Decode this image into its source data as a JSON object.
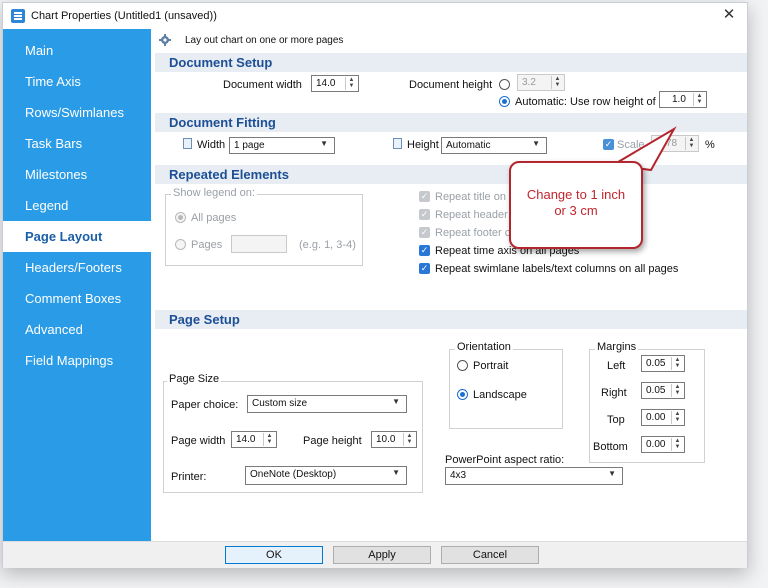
{
  "window": {
    "title": "Chart Properties (Untitled1 (unsaved))"
  },
  "sidebar": {
    "items": [
      {
        "label": "Main"
      },
      {
        "label": "Time Axis"
      },
      {
        "label": "Rows/Swimlanes"
      },
      {
        "label": "Task Bars"
      },
      {
        "label": "Milestones"
      },
      {
        "label": "Legend"
      },
      {
        "label": "Page Layout",
        "active": true
      },
      {
        "label": "Headers/Footers"
      },
      {
        "label": "Comment Boxes"
      },
      {
        "label": "Advanced"
      },
      {
        "label": "Field Mappings"
      }
    ]
  },
  "info": {
    "text": "Lay out chart on one or more pages"
  },
  "document_setup": {
    "title": "Document Setup",
    "width_label": "Document width",
    "width_value": "14.0",
    "height_label": "Document height",
    "height_value": "3.2",
    "automatic_label": "Automatic: Use row height of",
    "row_height_value": "1.0"
  },
  "document_fitting": {
    "title": "Document Fitting",
    "width_label": "Width",
    "width_value": "1 page",
    "height_label": "Height",
    "height_value": "Automatic",
    "scale_label": "Scale",
    "scale_value": "78",
    "percent": "%"
  },
  "repeated_elements": {
    "title": "Repeated Elements",
    "show_legend_label": "Show legend on:",
    "all_pages_label": "All pages",
    "pages_label": "Pages",
    "pages_hint": "(e.g. 1, 3-4)",
    "repeat_title": "Repeat title on",
    "repeat_header": "Repeat header",
    "repeat_footer": "Repeat footer c",
    "repeat_time_axis": "Repeat time axis on all pages",
    "repeat_swimlane": "Repeat swimlane labels/text columns on all pages"
  },
  "callout": {
    "line1": "Change to 1 inch",
    "line2": "or 3 cm"
  },
  "page_setup": {
    "title": "Page Setup",
    "orientation_label": "Orientation",
    "portrait_label": "Portrait",
    "landscape_label": "Landscape",
    "margins_label": "Margins",
    "left_label": "Left",
    "left_value": "0.05",
    "right_label": "Right",
    "right_value": "0.05",
    "top_label": "Top",
    "top_value": "0.00",
    "bottom_label": "Bottom",
    "bottom_value": "0.00",
    "page_size_label": "Page Size",
    "paper_choice_label": "Paper choice:",
    "paper_choice_value": "Custom size",
    "page_width_label": "Page width",
    "page_width_value": "14.0",
    "page_height_label": "Page height",
    "page_height_value": "10.0",
    "printer_label": "Printer:",
    "printer_value": "OneNote (Desktop)",
    "ppt_label": "PowerPoint aspect ratio:",
    "ppt_value": "4x3"
  },
  "buttons": {
    "ok": "OK",
    "apply": "Apply",
    "cancel": "Cancel"
  },
  "colors": {
    "sidebar": "#2a9be6",
    "section_text": "#1c4f95",
    "callout": "#b3262d"
  }
}
